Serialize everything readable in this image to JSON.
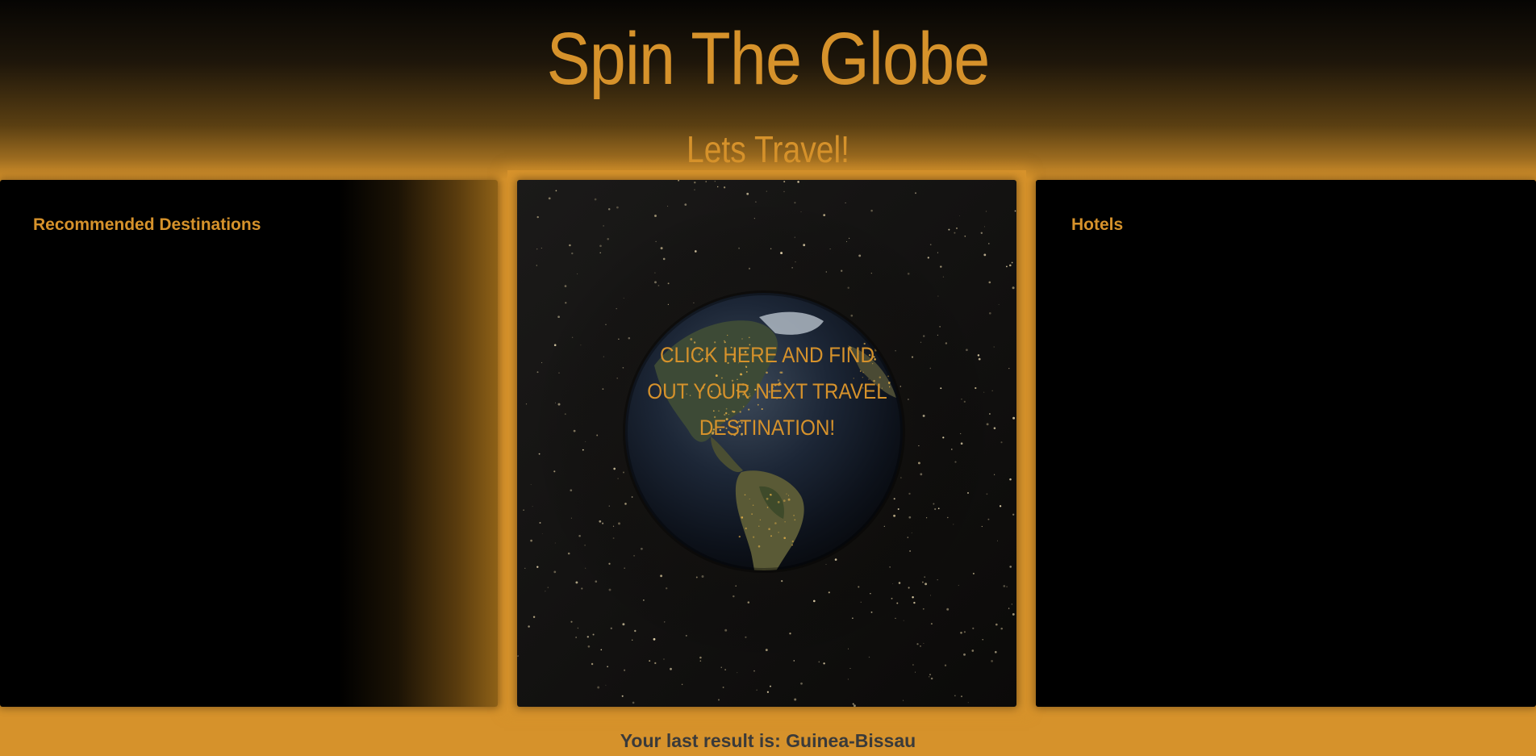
{
  "header": {
    "title": "Spin The Globe",
    "subtitle": "Lets Travel!"
  },
  "panels": {
    "left": {
      "heading": "Recommended Destinations"
    },
    "right": {
      "heading": "Hotels"
    }
  },
  "globe": {
    "cta_text": "CLICK HERE AND FIND OUT YOUR NEXT TRAVEL DESTINATION!",
    "image": "earth-globe-at-night"
  },
  "footer": {
    "result_text": "Your last result is: Guinea-Bissau"
  },
  "colors": {
    "accent": "#d6922b",
    "panel_bg": "#000000",
    "result_text": "#3a3a3a"
  }
}
